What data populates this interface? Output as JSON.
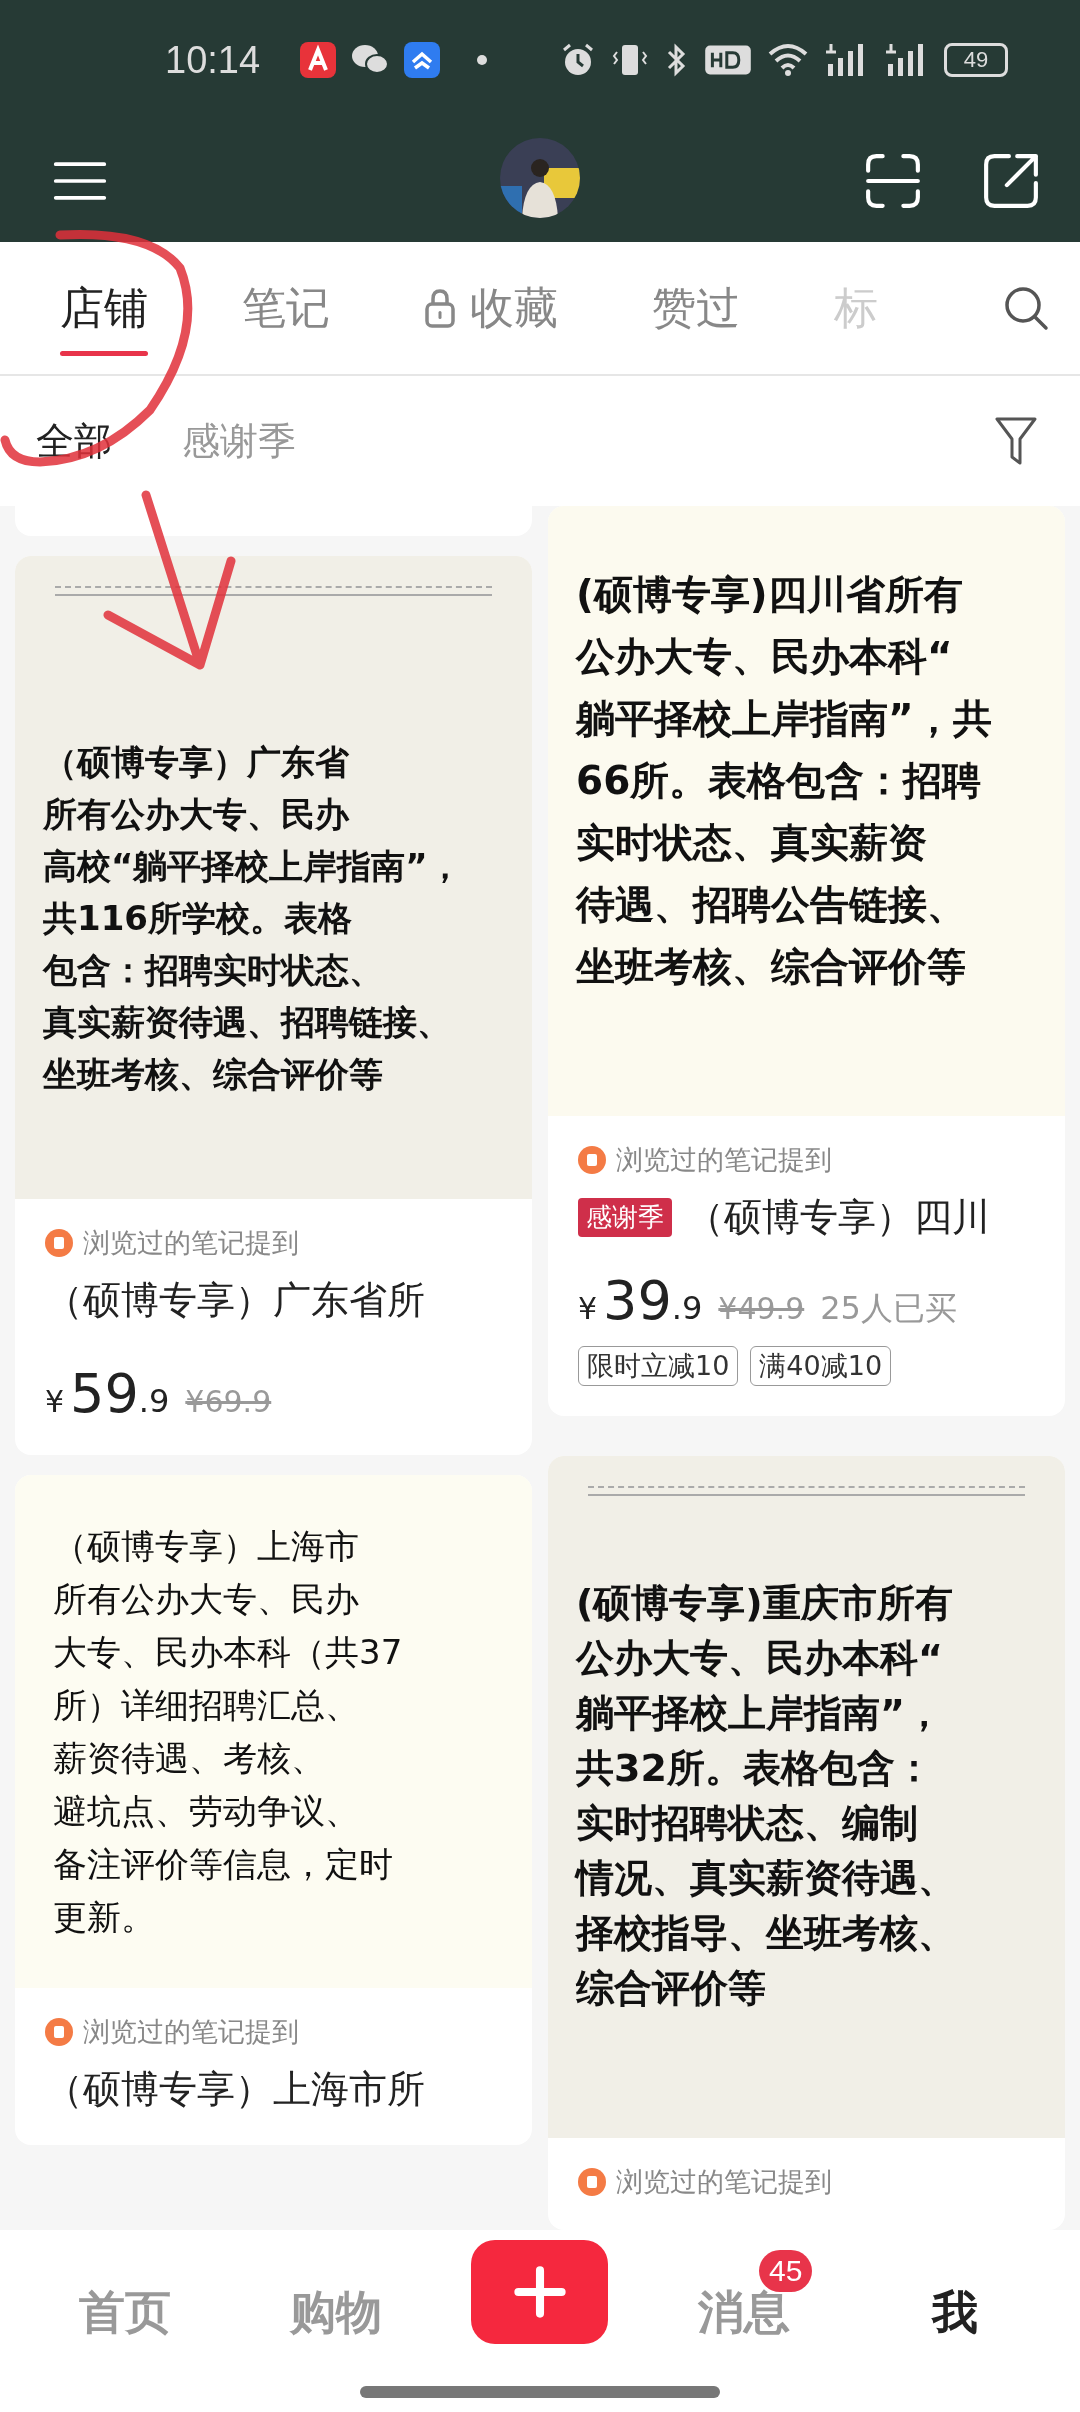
{
  "status_bar": {
    "time": "10:14",
    "battery": "49"
  },
  "tabs": [
    {
      "label": "店铺",
      "selected": true,
      "locked": false
    },
    {
      "label": "笔记",
      "selected": false,
      "locked": false
    },
    {
      "label": "收藏",
      "selected": false,
      "locked": true
    },
    {
      "label": "赞过",
      "selected": false,
      "locked": false
    },
    {
      "label": "标",
      "selected": false,
      "locked": false
    }
  ],
  "filters": [
    {
      "label": "全部",
      "selected": true
    },
    {
      "label": "感谢季",
      "selected": false
    }
  ],
  "columns": [
    [
      {
        "kind": "stub"
      },
      {
        "kind": "product",
        "cover": {
          "kind": "heavy",
          "rule": true,
          "lines": [
            "（硕博专享）广东省",
            "所有公办大专、民办",
            "高校“躺平择校上岸指南”，",
            "共116所学校。表格",
            "包含：招聘实时状态、",
            "真实薪资待遇、招聘链接、",
            "坐班考核、综合评价等"
          ]
        },
        "mention": "浏览过的笔记提到",
        "title": "（硕博专享）广东省所",
        "price": {
          "currency": "¥",
          "integer": "59",
          "decimal": ".9",
          "original": "¥69.9"
        }
      },
      {
        "kind": "product",
        "cover": {
          "kind": "regular",
          "rule": false,
          "lines": [
            "（硕博专享）上海市",
            "所有公办大专、民办",
            "大专、民办本科（共37",
            "所）详细招聘汇总、",
            "薪资待遇、考核、",
            "避坑点、劳动争议、",
            "备注评价等信息，定时",
            "更新。"
          ]
        },
        "mention": "浏览过的笔记提到",
        "title": "（硕博专享）上海市所"
      }
    ],
    [
      {
        "kind": "product",
        "cover": {
          "kind": "heavy",
          "rule": false,
          "lines": [
            "(硕博专享)四川省所有",
            "公办大专、民办本科“",
            "躺平择校上岸指南”，共",
            "66所。表格包含：招聘",
            "实时状态、真实薪资",
            "待遇、招聘公告链接、",
            "坐班考核、综合评价等"
          ]
        },
        "mention": "浏览过的笔记提到",
        "badge": "感谢季",
        "title": "（硕博专享）四川",
        "price": {
          "currency": "¥",
          "integer": "39",
          "decimal": ".9",
          "original": "¥49.9"
        },
        "sold": "25人已买",
        "tags": [
          "限时立减10",
          "满40减10"
        ]
      },
      {
        "kind": "product",
        "cover": {
          "kind": "heavy",
          "rule": true,
          "lines": [
            "(硕博专享)重庆市所有",
            "公办大专、民办本科“",
            "躺平择校上岸指南”，",
            "共32所。表格包含：",
            "实时招聘状态、编制",
            "情况、真实薪资待遇、",
            "择校指导、坐班考核、",
            "综合评价等"
          ]
        },
        "mention": "浏览过的笔记提到"
      }
    ]
  ],
  "nav": [
    {
      "kind": "text",
      "label": "首页",
      "selected": false
    },
    {
      "kind": "text",
      "label": "购物",
      "selected": false
    },
    {
      "kind": "plus"
    },
    {
      "kind": "text",
      "label": "消息",
      "selected": false,
      "badge": "45"
    },
    {
      "kind": "text",
      "label": "我",
      "selected": true
    }
  ]
}
